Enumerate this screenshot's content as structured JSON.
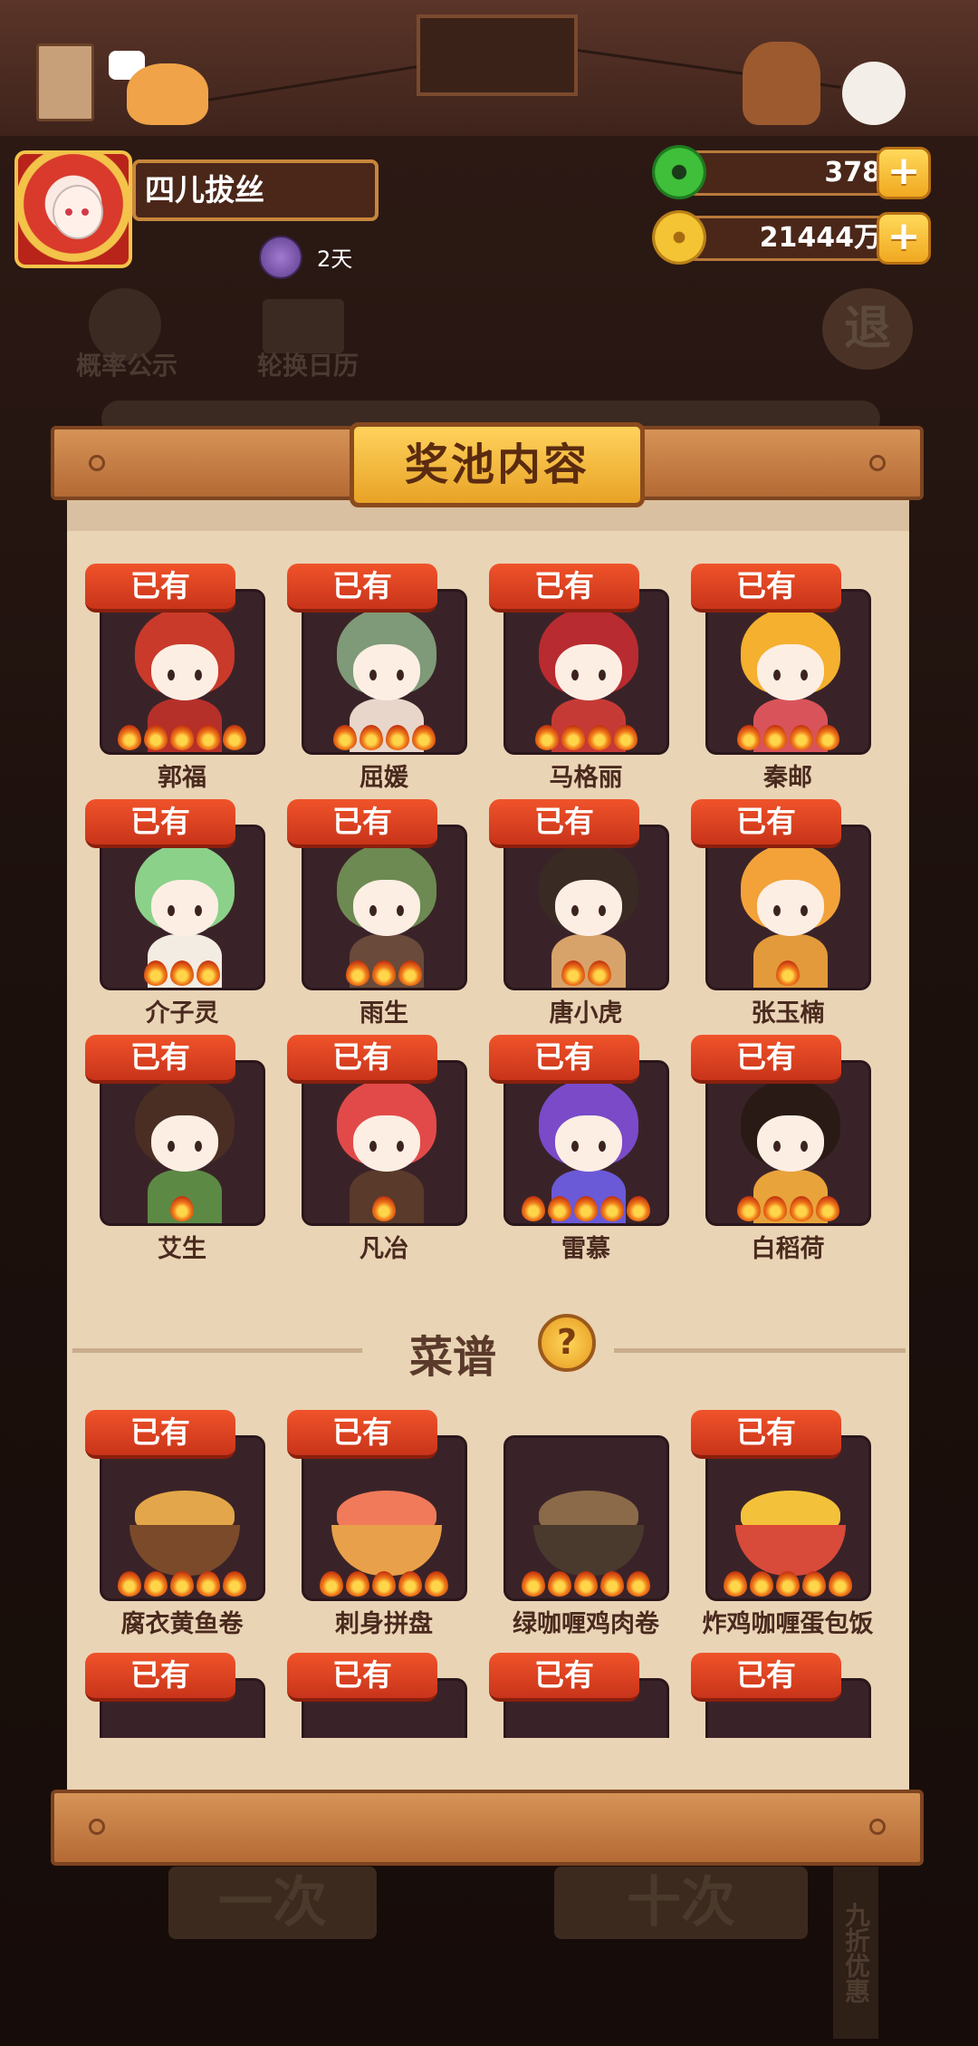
{
  "header": {
    "player_name": "四儿拔丝",
    "buff_days": "2天",
    "jade": "378",
    "coins": "21444万",
    "plus_label": "+"
  },
  "background_buttons": {
    "probability": "概率公示",
    "calendar": "轮换日历",
    "exit": "退",
    "one_draw": "一次",
    "ten_draw": "十次",
    "discount": "九折优惠"
  },
  "panel": {
    "title": "奖池内容",
    "owned_label": "已有",
    "recipe_section_title": "菜谱",
    "help_label": "?"
  },
  "characters": [
    {
      "name": "郭福",
      "stars": 5,
      "owned": true,
      "hair": "#c93a2a",
      "body": "#b6302a"
    },
    {
      "name": "屈媛",
      "stars": 4,
      "owned": true,
      "hair": "#7f9a78",
      "body": "#e8d6cb"
    },
    {
      "name": "马格丽",
      "stars": 4,
      "owned": true,
      "hair": "#b82b30",
      "body": "#c63a36"
    },
    {
      "name": "秦邮",
      "stars": 4,
      "owned": true,
      "hair": "#f4b02e",
      "body": "#d9545a"
    },
    {
      "name": "介子灵",
      "stars": 3,
      "owned": true,
      "hair": "#8bd18a",
      "body": "#f3ece2"
    },
    {
      "name": "雨生",
      "stars": 3,
      "owned": true,
      "hair": "#6d8a52",
      "body": "#6a4a3a"
    },
    {
      "name": "唐小虎",
      "stars": 2,
      "owned": true,
      "hair": "#3a2a24",
      "body": "#d7a36a"
    },
    {
      "name": "张玉楠",
      "stars": 1,
      "owned": true,
      "hair": "#f3a23a",
      "body": "#e39a3a"
    },
    {
      "name": "艾生",
      "stars": 1,
      "owned": true,
      "hair": "#4a2e24",
      "body": "#5c8a45"
    },
    {
      "name": "凡冶",
      "stars": 1,
      "owned": true,
      "hair": "#e24a4a",
      "body": "#5a3a2a"
    },
    {
      "name": "雷慕",
      "stars": 5,
      "owned": true,
      "hair": "#7a4ac8",
      "body": "#6a5ad8"
    },
    {
      "name": "白稻荷",
      "stars": 4,
      "owned": true,
      "hair": "#2a1a16",
      "body": "#e8a33a"
    }
  ],
  "recipes": [
    {
      "name": "腐衣黄鱼卷",
      "stars": 5,
      "owned": true,
      "food": "#e3a64a",
      "bowl": "#7a4a2a"
    },
    {
      "name": "刺身拼盘",
      "stars": 5,
      "owned": true,
      "food": "#f07a5a",
      "bowl": "#e8a04a"
    },
    {
      "name": "绿咖喱鸡肉卷",
      "stars": 5,
      "owned": false,
      "food": "#8a6a48",
      "bowl": "#4a3a2e"
    },
    {
      "name": "炸鸡咖喱蛋包饭",
      "stars": 5,
      "owned": true,
      "food": "#f4c23a",
      "bowl": "#d84a3a"
    }
  ],
  "recipes_partial": [
    {
      "owned": true
    },
    {
      "owned": true
    },
    {
      "owned": true
    },
    {
      "owned": true
    }
  ],
  "colors": {
    "owned_badge": "#e0441f",
    "card_bg": "#3a2328",
    "panel_bg": "#ead4b6",
    "title_plate": "#f5bb3a"
  }
}
